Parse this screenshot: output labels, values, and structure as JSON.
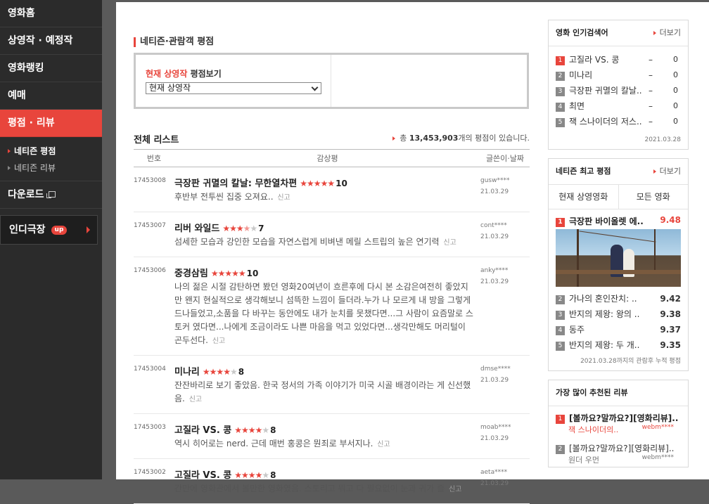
{
  "nav": {
    "items": [
      "영화홈",
      "상영작 · 예정작",
      "영화랭킹",
      "예매",
      "평점 · 리뷰"
    ],
    "sub": [
      "네티즌 평점",
      "네티즌 리뷰"
    ],
    "download": "다운로드",
    "indie": "인디극장",
    "up_badge": "up"
  },
  "header": {
    "title": "네티즌·관람객 평점",
    "select_label_highlight": "현재 상영작",
    "select_label_rest": " 평점보기",
    "select_value": "현재 상영작"
  },
  "list": {
    "title": "전체 리스트",
    "total_prefix": "총 ",
    "total_count": "13,453,903",
    "total_suffix": "개의 평점이 있습니다.",
    "columns": [
      "번호",
      "감상평",
      "글쓴이·날짜"
    ],
    "report_label": "신고",
    "rows": [
      {
        "num": "17453008",
        "movie": "극장판 귀멸의 칼날: 무한열차편",
        "stars": 5,
        "score": "10",
        "text": "후반부 전투씬 집중 오져요..",
        "author": "gusw****",
        "date": "21.03.29"
      },
      {
        "num": "17453007",
        "movie": "리버 와일드",
        "stars": 3.5,
        "score": "7",
        "text": "섬세한 모습과 강인한 모습을 자연스럽게 비벼낸 메릴 스트립의 높은 연기력",
        "author": "cont****",
        "date": "21.03.29"
      },
      {
        "num": "17453006",
        "movie": "중경삼림",
        "stars": 5,
        "score": "10",
        "text": "나의 젊은 시절 감탄하면 봤던 영화20여년이 흐른후에 다시 본 소감은여전히 좋았지만 왠지 현실적으로 생각해보니 섬뜩한 느낌이 들더라.누가 나 모르게 내 방을 그렇게 드나들었고,소품을 다 바꾸는 동안에도 내가 눈치를 못챘다면...그 사람이 요즘말로 스토커 였다면...나에게 조금이라도 나쁜 마음을 먹고 있었다면...생각만해도 머리털이 곤두선다.",
        "author": "anky****",
        "date": "21.03.29"
      },
      {
        "num": "17453004",
        "movie": "미나리",
        "stars": 4,
        "score": "8",
        "text": "잔잔바리로 보기 좋았음. 한국 정서의 가족 이야기가 미국 시골 배경이라는 게 신선했음.",
        "author": "dmse****",
        "date": "21.03.29"
      },
      {
        "num": "17453003",
        "movie": "고질라 VS. 콩",
        "stars": 4,
        "score": "8",
        "text": "역시 히어로는 nerd. 근데 매번 홍콩은 뭔죄로 부서지나.",
        "author": "moab****",
        "date": "21.03.29"
      },
      {
        "num": "17453002",
        "movie": "고질라 VS. 콩",
        "stars": 4,
        "score": "8",
        "text": "간만에 영화관에서 볼만한 영화였음. 스토리고 뭐고 다 필요없이 눈과 귀가 즐",
        "author": "aeta****",
        "date": "21.03.29"
      }
    ]
  },
  "search_rank": {
    "title": "영화 인기검색어",
    "more": "더보기",
    "items": [
      {
        "rank": "1",
        "name": "고질라 VS. 콩",
        "chg": "–",
        "val": "0"
      },
      {
        "rank": "2",
        "name": "미나리",
        "chg": "–",
        "val": "0"
      },
      {
        "rank": "3",
        "name": "극장판 귀멸의 칼날..",
        "chg": "–",
        "val": "0"
      },
      {
        "rank": "4",
        "name": "최면",
        "chg": "–",
        "val": "0"
      },
      {
        "rank": "5",
        "name": "잭 스나이더의 저스..",
        "chg": "–",
        "val": "0"
      }
    ],
    "date": "2021.03.28"
  },
  "best": {
    "title": "네티즌 최고 평점",
    "more": "더보기",
    "tabs": [
      "현재 상영영화",
      "모든 영화"
    ],
    "top": {
      "rank": "1",
      "name": "극장판 바이올렛 에..",
      "score": "9.48"
    },
    "items": [
      {
        "rank": "2",
        "name": "가나의 혼인잔치: ..",
        "score": "9.42"
      },
      {
        "rank": "3",
        "name": "반지의 제왕: 왕의 ..",
        "score": "9.38"
      },
      {
        "rank": "4",
        "name": "동주",
        "score": "9.37"
      },
      {
        "rank": "5",
        "name": "반지의 제왕: 두 개..",
        "score": "9.35"
      }
    ],
    "date": "2021.03.28까지의 관람후 누적 평점"
  },
  "recommend": {
    "title": "가장 많이 추천된 리뷰",
    "items": [
      {
        "rank": "1",
        "title": "[볼까요?말까요?][영화리뷰]..",
        "movie": "잭 스나이더의..",
        "author": "webm****"
      },
      {
        "rank": "2",
        "title": "[볼까요?말까요?][영화리뷰]..",
        "movie": "원더 우먼",
        "author": "webm****"
      }
    ]
  },
  "colors": {
    "accent": "#e8453c",
    "sidebar": "#2b2b2b"
  }
}
